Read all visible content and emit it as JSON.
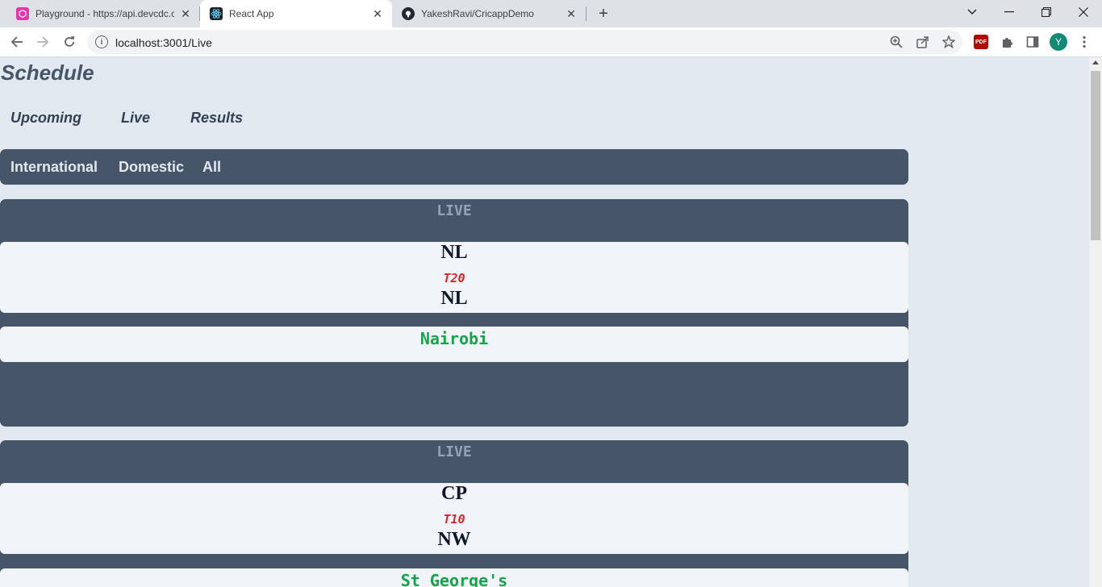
{
  "browser": {
    "tabs": [
      {
        "title": "Playground - https://api.devcdc.c",
        "favicon_color": "#e535ab"
      },
      {
        "title": "React App",
        "favicon_color": "#20232a"
      },
      {
        "title": "YakeshRavi/CricappDemo",
        "favicon_color": "#24292f"
      }
    ],
    "url": "localhost:3001/Live",
    "profile_initial": "Y",
    "pdf_ext_label": "PDF"
  },
  "page": {
    "title": "Schedule",
    "status_tabs": [
      "Upcoming",
      "Live",
      "Results"
    ],
    "filters": [
      "International",
      "Domestic",
      "All"
    ],
    "matches": [
      {
        "status": "LIVE",
        "team1": "NL",
        "format": "T20",
        "team2": "NL",
        "venue": "Nairobi"
      },
      {
        "status": "LIVE",
        "team1": "CP",
        "format": "T10",
        "team2": "NW",
        "venue": "St George's"
      }
    ]
  },
  "colors": {
    "page_bg": "#e2e8f0",
    "card_bg": "#475569",
    "format_red": "#dc2626",
    "venue_green": "#16a34a"
  }
}
